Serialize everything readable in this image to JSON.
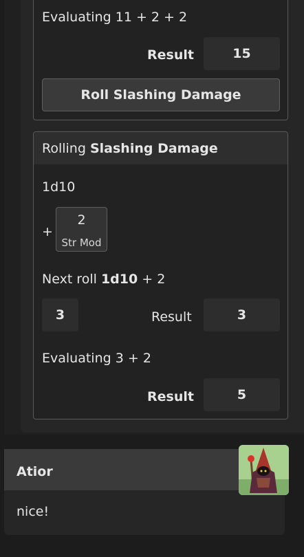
{
  "first_card": {
    "evaluating": "Evaluating 11 + 2 + 2",
    "result_label": "Result",
    "result_value": "15",
    "roll_button": "Roll Slashing Damage"
  },
  "second_card": {
    "header_prefix": "Rolling",
    "header_bold": "Slashing Damage",
    "formula": "1d10",
    "plus": "+",
    "modifier_value": "2",
    "modifier_label": "Str Mod",
    "next_roll_prefix": "Next roll",
    "next_roll_bold": "1d10",
    "next_roll_suffix": "+ 2",
    "die_value": "3",
    "result_label_1": "Result",
    "result_value_1": "3",
    "evaluating": "Evaluating 3 + 2",
    "result_label_2": "Result",
    "result_value_2": "5"
  },
  "message": {
    "author": "Atior",
    "text": "nice!",
    "avatar_icon": "hooded-wizard-avatar"
  }
}
